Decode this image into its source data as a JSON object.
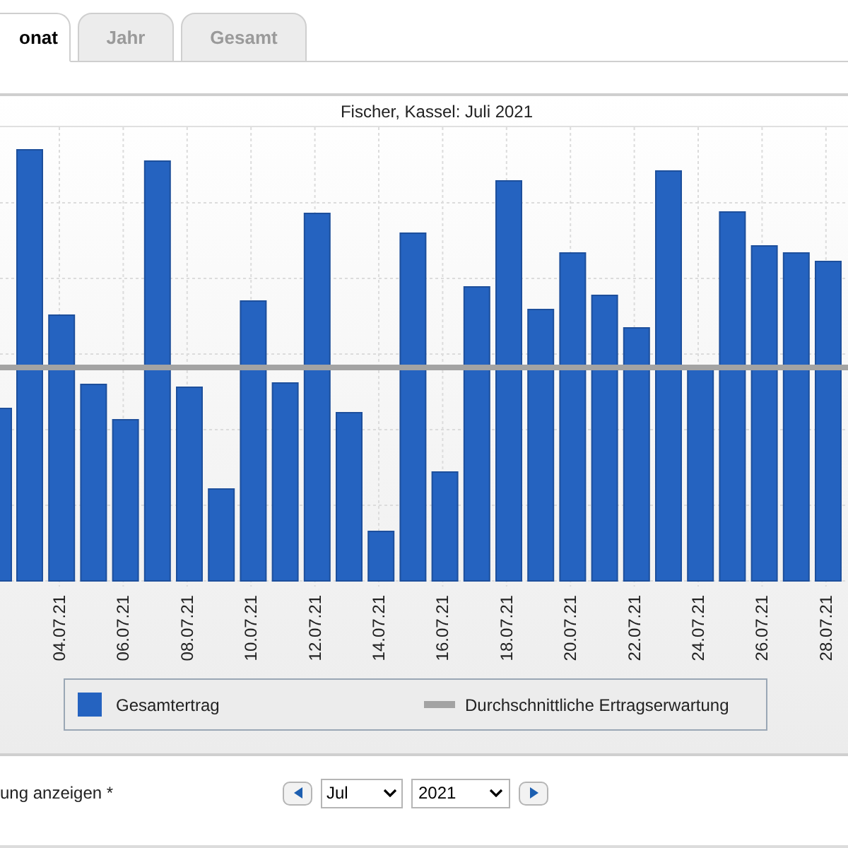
{
  "tabs": [
    {
      "label": "onat",
      "selected": true
    },
    {
      "label": "Jahr",
      "selected": false
    },
    {
      "label": "Gesamt",
      "selected": false
    }
  ],
  "chart": {
    "title": "Fischer, Kassel: Juli 2021",
    "x_labels": [
      "04.07.21",
      "06.07.21",
      "08.07.21",
      "10.07.21",
      "12.07.21",
      "14.07.21",
      "16.07.21",
      "18.07.21",
      "20.07.21",
      "22.07.21",
      "24.07.21",
      "26.07.21",
      "28.07.21"
    ],
    "legend": [
      {
        "kind": "bar",
        "label": "Gesamtertrag",
        "color": "#2563c0"
      },
      {
        "kind": "line",
        "label": "Durchschnittliche Ertragserwartung",
        "color": "#a3a3a3"
      }
    ]
  },
  "footer": {
    "note": "ung anzeigen *",
    "month": "Jul",
    "year": "2021"
  }
}
